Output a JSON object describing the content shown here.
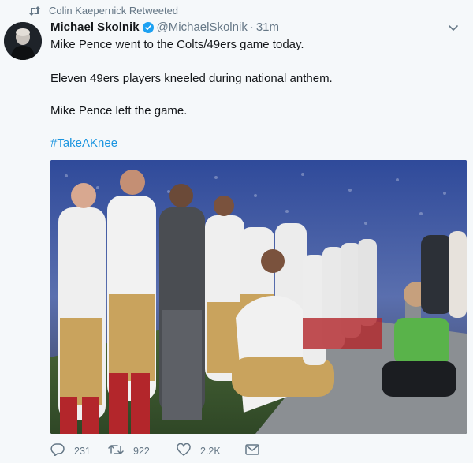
{
  "retweet_context": {
    "text": "Colin Kaepernick Retweeted",
    "icon": "retweet-icon"
  },
  "tweet": {
    "author_name": "Michael Skolnik",
    "handle": "@MichaelSkolnik",
    "separator": "·",
    "timestamp": "31m",
    "verified": true,
    "lines": [
      "Mike Pence went to the Colts/49ers game today.",
      "Eleven 49ers players kneeled during national anthem.",
      "Mike Pence left the game."
    ],
    "hashtag": "#TakeAKnee",
    "media": {
      "kind": "photo",
      "watermark": "",
      "content": "stadium-crowd-and-kneeling-players"
    }
  },
  "actions": {
    "reply_count": "231",
    "retweet_count": "922",
    "like_count": "2.2K"
  },
  "colors": {
    "background": "#f5f8fa",
    "text": "#14171a",
    "secondary": "#657786",
    "link": "#1b95e0",
    "verified": "#1da1f2"
  }
}
